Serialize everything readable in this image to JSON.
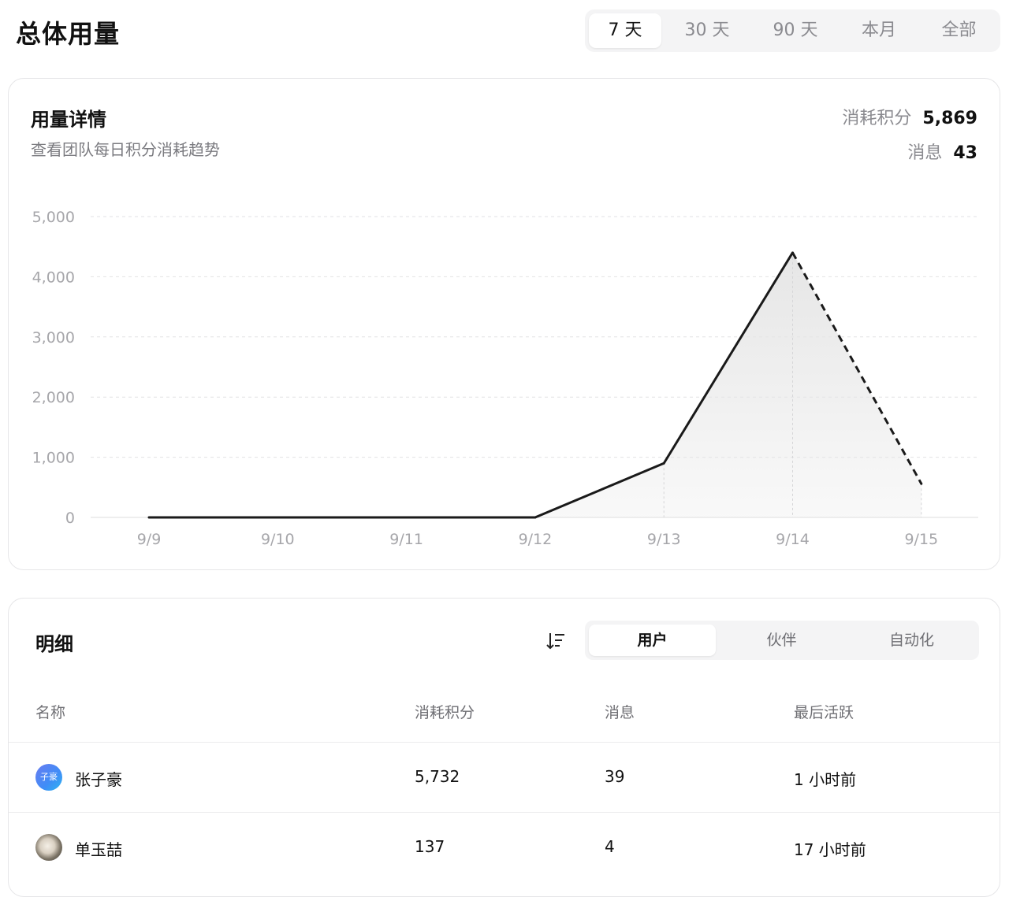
{
  "page": {
    "title": "总体用量"
  },
  "range_tabs": [
    {
      "label": "7 天",
      "active": true
    },
    {
      "label": "30 天",
      "active": false
    },
    {
      "label": "90 天",
      "active": false
    },
    {
      "label": "本月",
      "active": false
    },
    {
      "label": "全部",
      "active": false
    }
  ],
  "usage": {
    "title": "用量详情",
    "subtitle": "查看团队每日积分消耗趋势",
    "credits_label": "消耗积分",
    "credits_value": "5,869",
    "messages_label": "消息",
    "messages_value": "43"
  },
  "chart_data": {
    "type": "area",
    "categories": [
      "9/9",
      "9/10",
      "9/11",
      "9/12",
      "9/13",
      "9/14",
      "9/15"
    ],
    "values": [
      0,
      0,
      0,
      0,
      900,
      4400,
      560
    ],
    "ylim": [
      0,
      5000
    ],
    "yticks": [
      0,
      1000,
      2000,
      3000,
      4000,
      5000
    ],
    "ytick_labels": [
      "0",
      "1,000",
      "2,000",
      "3,000",
      "4,000",
      "5,000"
    ],
    "grid": true,
    "last_segment_dashed": true,
    "line_color": "#1a1a1a",
    "fill_color": "#e6e6e6"
  },
  "detail": {
    "title": "明细",
    "sort_icon": "sort-icon",
    "tabs": [
      {
        "label": "用户",
        "active": true
      },
      {
        "label": "伙伴",
        "active": false
      },
      {
        "label": "自动化",
        "active": false
      }
    ],
    "columns": [
      "名称",
      "消耗积分",
      "消息",
      "最后活跃"
    ],
    "rows": [
      {
        "avatar_text": "子豪",
        "name": "张子豪",
        "credits": "5,732",
        "messages": "39",
        "last_active": "1 小时前"
      },
      {
        "avatar_text": "",
        "name": "单玉喆",
        "credits": "137",
        "messages": "4",
        "last_active": "17 小时前"
      }
    ]
  }
}
